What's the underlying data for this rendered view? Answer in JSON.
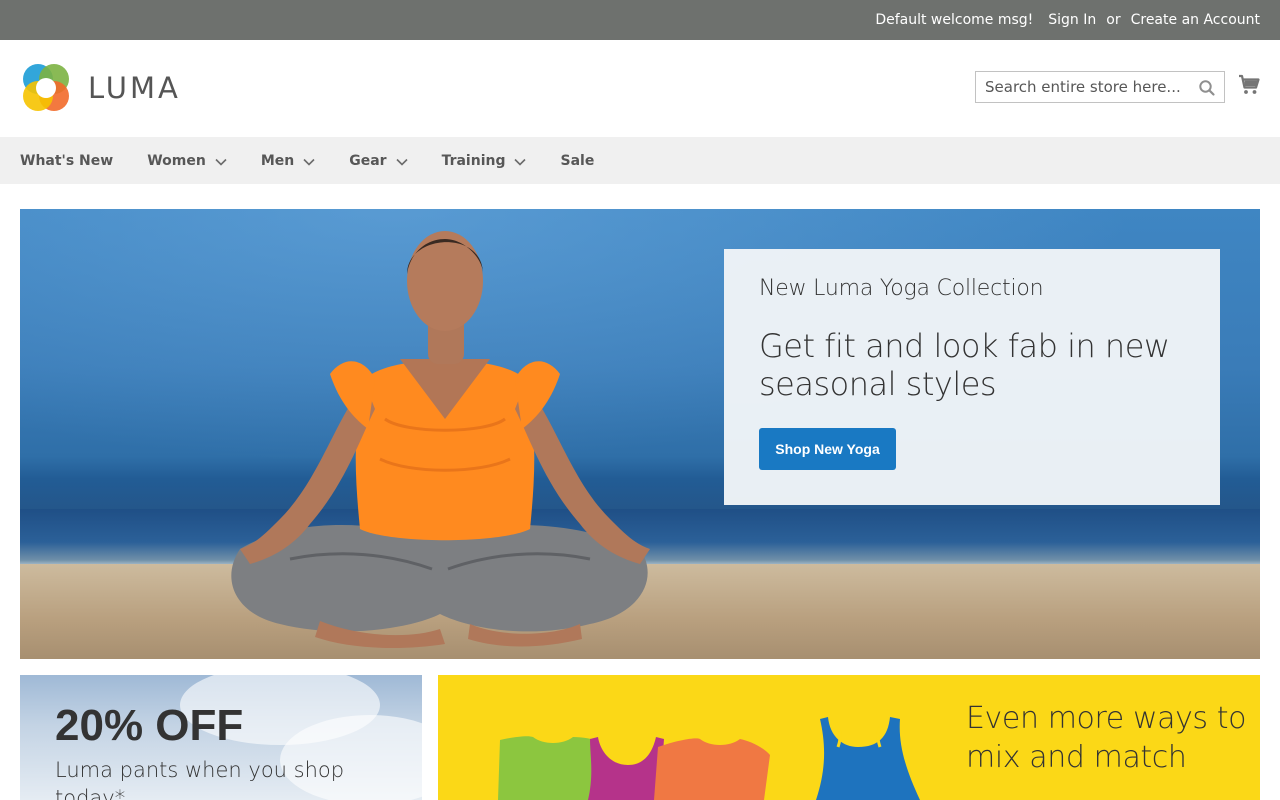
{
  "topbar": {
    "welcome": "Default welcome msg!",
    "sign_in": "Sign In",
    "or": "or",
    "create_account": "Create an Account"
  },
  "header": {
    "logo_text": "LUMA",
    "search_placeholder": "Search entire store here...",
    "icons": [
      "search-icon",
      "cart-icon"
    ]
  },
  "nav": {
    "items": [
      {
        "label": "What's New",
        "has_dropdown": false
      },
      {
        "label": "Women",
        "has_dropdown": true
      },
      {
        "label": "Men",
        "has_dropdown": true
      },
      {
        "label": "Gear",
        "has_dropdown": true
      },
      {
        "label": "Training",
        "has_dropdown": true
      },
      {
        "label": "Sale",
        "has_dropdown": false
      }
    ]
  },
  "hero": {
    "kicker": "New Luma Yoga Collection",
    "title": "Get fit and look fab in new seasonal styles",
    "button": "Shop New Yoga"
  },
  "promos": {
    "left": {
      "headline": "20% OFF",
      "subtext": "Luma pants when you shop today*"
    },
    "right": {
      "title": "Even more ways to mix and match"
    }
  },
  "colors": {
    "topbar_bg": "#6e716e",
    "nav_bg": "#f0f0f0",
    "accent_blue": "#1979c3",
    "promo_yellow": "#fbd817"
  }
}
